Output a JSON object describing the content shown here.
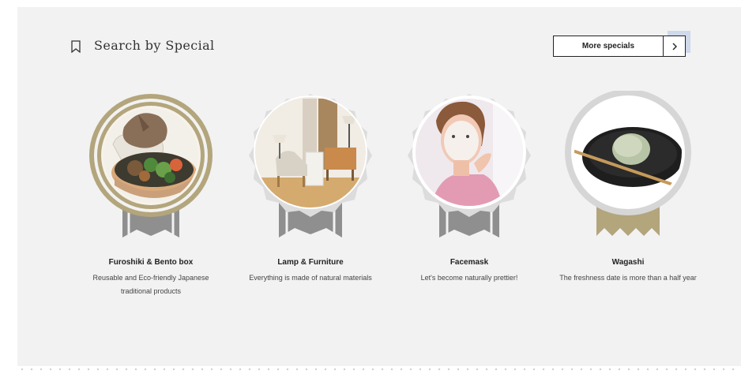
{
  "header": {
    "title": "Search by Special",
    "more_label": "More specials",
    "icon": "bookmark-icon",
    "next_icon": "chevron-right-icon"
  },
  "colors": {
    "gold": "#b3a57c",
    "silver": "#c9c9c9",
    "ribbon_gray": "#8f8f8f",
    "panel_bg": "#f2f2f2"
  },
  "items": [
    {
      "title": "Furoshiki & Bento box",
      "description": "Reusable and Eco-friendly Japanese traditional products"
    },
    {
      "title": "Lamp & Furniture",
      "description": "Everything is made of natural materials"
    },
    {
      "title": "Facemask",
      "description": "Let's become naturally prettier!"
    },
    {
      "title": "Wagashi",
      "description": "The freshness date is more than a half year"
    }
  ]
}
